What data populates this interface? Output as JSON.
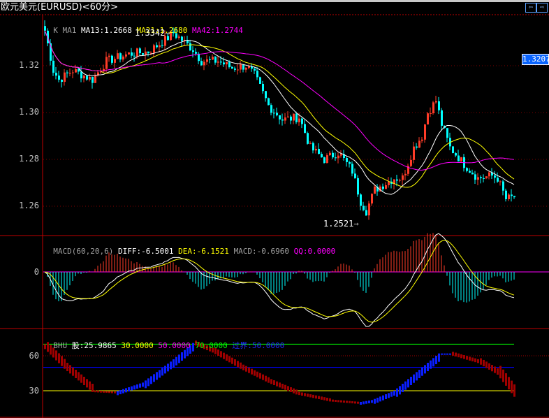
{
  "header": {
    "title": "欧元美元(EURUSD)<60分>",
    "nav_prev_icon": "arrow-left-icon",
    "nav_next_icon": "arrow-right-icon"
  },
  "main_legend": {
    "k": "K",
    "ma1": "MA1",
    "ma13": "MA13:1.2668",
    "ma21": "MA21:1.2680",
    "ma42": "MA42:1.2744"
  },
  "macd_legend": {
    "name": "MACD(60,20,6)",
    "diff": "DIFF:-6.5001",
    "dea": "DEA:-6.1521",
    "macd": "MACD:-0.6960",
    "qq": "QQ:0.0000"
  },
  "bhu_legend": {
    "name": "BHU",
    "gu": "股:25.9865",
    "l30": "30.0000",
    "l50": "50.0000",
    "l70": "70.0000",
    "guojie": "过界:50.0000"
  },
  "price_tag": "1.3207",
  "high_marker": "1.3342",
  "low_marker": "1.2521",
  "colors": {
    "up": "#ff3c28",
    "down": "#00ffff",
    "ma13": "#ffffff",
    "ma21": "#ffff00",
    "ma42": "#ff00ff",
    "grid_red": "#c00000",
    "bhu_up": "#0a1eff",
    "bhu_down": "#a00000"
  },
  "chart_data": [
    {
      "type": "candlestick",
      "title": "欧元美元(EURUSD)<60分>",
      "y_ticks": [
        "1.32",
        "1.30",
        "1.28",
        "1.26"
      ],
      "ylim": [
        1.249,
        1.342
      ],
      "close_keypoints": [
        [
          0,
          1.335
        ],
        [
          3,
          1.318
        ],
        [
          5,
          1.314
        ],
        [
          10,
          1.318
        ],
        [
          17,
          1.314
        ],
        [
          22,
          1.322
        ],
        [
          30,
          1.325
        ],
        [
          37,
          1.326
        ],
        [
          43,
          1.331
        ],
        [
          46,
          1.334
        ],
        [
          50,
          1.33
        ],
        [
          53,
          1.327
        ],
        [
          56,
          1.322
        ],
        [
          62,
          1.322
        ],
        [
          67,
          1.319
        ],
        [
          72,
          1.32
        ],
        [
          75,
          1.316
        ],
        [
          80,
          1.303
        ],
        [
          85,
          1.297
        ],
        [
          91,
          1.298
        ],
        [
          95,
          1.285
        ],
        [
          100,
          1.28
        ],
        [
          105,
          1.283
        ],
        [
          110,
          1.275
        ],
        [
          113,
          1.262
        ],
        [
          115,
          1.258
        ],
        [
          118,
          1.267
        ],
        [
          125,
          1.272
        ],
        [
          128,
          1.272
        ],
        [
          132,
          1.285
        ],
        [
          135,
          1.29
        ],
        [
          137,
          1.3
        ],
        [
          140,
          1.305
        ],
        [
          142,
          1.295
        ],
        [
          145,
          1.285
        ],
        [
          150,
          1.278
        ],
        [
          155,
          1.272
        ],
        [
          160,
          1.273
        ],
        [
          162,
          1.272
        ],
        [
          165,
          1.263
        ],
        [
          168,
          1.264
        ]
      ],
      "moving_averages": [
        13,
        21,
        42
      ]
    },
    {
      "type": "line",
      "title": "MACD(60,20,6)",
      "y_ticks": [
        "0"
      ],
      "series": [
        {
          "name": "DIFF"
        },
        {
          "name": "DEA"
        },
        {
          "name": "MACD"
        }
      ]
    },
    {
      "type": "bar",
      "title": "BHU",
      "y_ticks": [
        "60",
        "30"
      ],
      "ylim": [
        16,
        76
      ],
      "reference_lines": [
        30,
        50,
        60,
        70
      ],
      "keypoints": [
        [
          0,
          67
        ],
        [
          7,
          50
        ],
        [
          17,
          30
        ],
        [
          25,
          29
        ],
        [
          35,
          37
        ],
        [
          45,
          55
        ],
        [
          53,
          71
        ],
        [
          60,
          64
        ],
        [
          70,
          50
        ],
        [
          80,
          38
        ],
        [
          90,
          28
        ],
        [
          102,
          22
        ],
        [
          112,
          20
        ],
        [
          117,
          22
        ],
        [
          125,
          30
        ],
        [
          135,
          50
        ],
        [
          141,
          62
        ],
        [
          145,
          62
        ],
        [
          155,
          55
        ],
        [
          162,
          45
        ],
        [
          168,
          26
        ]
      ]
    }
  ]
}
